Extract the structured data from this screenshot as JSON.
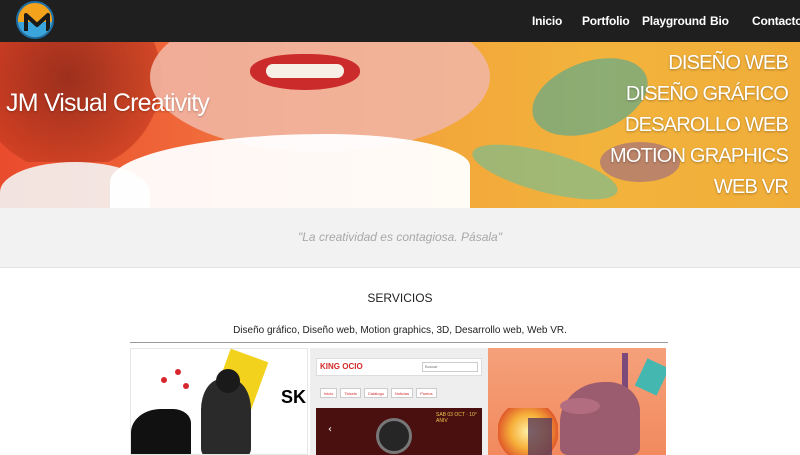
{
  "navbar": {
    "logo_icon": "logo-m-icon",
    "items": [
      {
        "label": "Inicio"
      },
      {
        "label": "Portfolio"
      },
      {
        "label": "Playground"
      },
      {
        "label": "Bio"
      },
      {
        "label": "Contacto"
      }
    ]
  },
  "hero": {
    "title": "JM Visual Creativity",
    "services": [
      "DISEÑO WEB",
      "DISEÑO GRÁFICO",
      "DESAROLLO WEB",
      "MOTION GRAPHICS",
      "WEB VR"
    ]
  },
  "quote": "\"La creatividad es contagiosa. Pásala\"",
  "services_section": {
    "title": "SERVICIOS",
    "subtitle": "Diseño gráfico, Diseño web, Motion graphics, 3D, Desarrollo web, Web VR."
  },
  "thumbs": {
    "t1": {
      "text": "SK"
    },
    "t2": {
      "logo": "KING OCIO",
      "search_placeholder": "Buscar",
      "menu": [
        "Inicio",
        "Tickets",
        "Catálogo",
        "Noticias",
        "Puntos"
      ],
      "banner_text": "SAB 03 OCT · 10° ANIV"
    },
    "t3": {}
  },
  "colors": {
    "navbar": "#1f1f1f",
    "hero_accent": "#f0ad39",
    "quote_band": "#f2f2f2"
  }
}
